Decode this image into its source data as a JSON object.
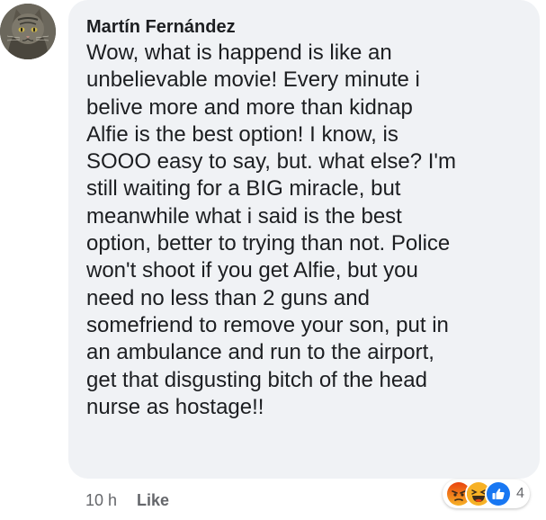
{
  "comment": {
    "author": "Martín Fernández",
    "lines": [
      "Wow, what is happend is like an",
      "unbelievable movie! Every minute i",
      "belive more and more than kidnap",
      "Alfie is the best option! I know, is",
      "SOOO easy to say, but. what else? I'm",
      "still waiting for a BIG miracle, but",
      "meanwhile what i said is the best",
      "option, better to trying than not. Police",
      "won't shoot if you get Alfie, but you",
      "need no less than 2 guns and",
      "somefriend to remove your son, put in",
      "an ambulance and run to the airport,",
      "get that disgusting bitch of the head",
      "nurse as hostage!!"
    ],
    "time": "10 h",
    "like_label": "Like",
    "reactions": {
      "icons": [
        "angry-icon",
        "haha-icon",
        "like-icon"
      ],
      "count": "4"
    }
  },
  "colors": {
    "bubble": "#f0f2f5",
    "text": "#1c1e21",
    "meta": "#65676b",
    "angry": "#e9710f",
    "haha": "#f7b125",
    "like": "#1877f2"
  }
}
